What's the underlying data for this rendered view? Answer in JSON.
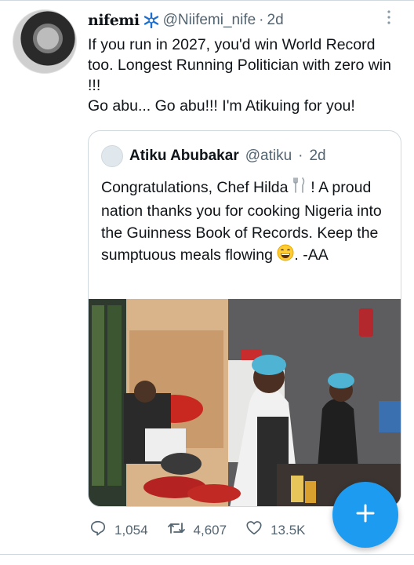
{
  "tweet": {
    "display_name_main": "nifemi",
    "display_name_small": "mi",
    "handle": "@Niifemi_nife",
    "dot": "·",
    "time": "2d",
    "text": "If you run in 2027, you'd win World Record too. Longest Running Politician with zero win !!!\nGo abu... Go abu!!! I'm Atikuing for you!"
  },
  "quote": {
    "name": "Atiku Abubakar",
    "handle": "@atiku",
    "dot": "·",
    "time": "2d",
    "text_part1": "Congratulations, Chef Hilda ",
    "text_part2": " ! A proud nation thanks you for cooking Nigeria into the Guinness Book of Records. Keep the sumptuous meals flowing ",
    "text_part3": ". -AA"
  },
  "actions": {
    "replies": "1,054",
    "retweets": "4,607",
    "likes": "13.5K"
  },
  "icons": {
    "more": "more-icon",
    "reply": "reply-icon",
    "retweet": "retweet-icon",
    "like": "heart-icon",
    "fab": "plus-icon"
  },
  "colors": {
    "accent": "#1d9bf0",
    "secondary_text": "#536471",
    "border": "#cfd9de"
  }
}
